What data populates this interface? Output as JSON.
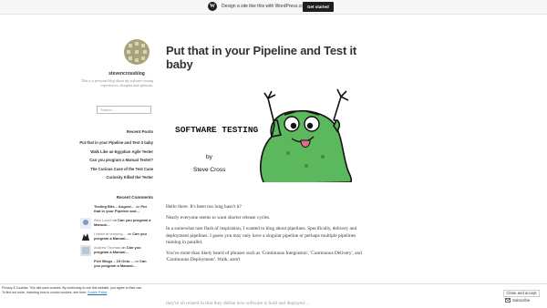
{
  "banner": {
    "text": "Design a site like this with WordPress.com",
    "button": "Get started"
  },
  "site": {
    "title": "stevencrossblog",
    "description": "This is a personal blog about my software testing experiences, thoughts and opinions."
  },
  "search": {
    "placeholder": "Search …"
  },
  "recent_posts": {
    "title": "Recent Posts",
    "items": [
      "Put that in your Pipeline and Test it baby",
      "Walk Like an Egyptian Agile Tester",
      "Can you program a Manual Tester?",
      "The Curious Case of the Test Case",
      "Curiosity Killed the Tester"
    ]
  },
  "recent_comments": {
    "title": "Recent Comments",
    "items": [
      {
        "author": "Testing Bits – August…",
        "on": "on",
        "post": "Put that in your Pipeline and…"
      },
      {
        "author": "Alex Lovell",
        "on": "on",
        "post": "Can you program a Manual…"
      },
      {
        "author": "I failed at learning…",
        "on": "on",
        "post": "Can you program a Manual…"
      },
      {
        "author": "Andrew Thomas",
        "on": "on",
        "post": "Can you program a Manual…"
      },
      {
        "author": "Five Blogs – 19 Octo…",
        "on": "on",
        "post": "Can you program a Manual…"
      }
    ]
  },
  "post": {
    "title": "Put that in your Pipeline and Test it baby",
    "hero": {
      "heading": "SOFTWARE TESTING",
      "by": "by",
      "author": "Steve Cross"
    },
    "paragraphs": [
      "Hello there. It's been too long hasn't it?",
      "Nearly everyone seems to want shorter release cycles.",
      "In a somewhat rare flash of inspiration, I wanted to blog about pipelines. Specifically, delivery and deployment pipelines. I guess you may only have a singular pipeline or perhaps multiple pipelines running in parallel.",
      "You've more than likely heard of phrases such as 'Continuous Integration', 'Continuous Delivery', and 'Continuous Deployment'. Walk, aren't"
    ],
    "overflow": "they're all related in that they define how software is built and deployed…"
  },
  "cookie": {
    "text": "Privacy & Cookies: This site uses cookies. By continuing to use this website, you agree to their use.",
    "more": "To find out more, including how to control cookies, see here:",
    "link": "Cookie Policy",
    "close": "Close and accept"
  },
  "subscribe": {
    "label": "Subscribe"
  },
  "colors": {
    "banner_bg": "#f6f7f7",
    "button_bg": "#1e1e1e",
    "mascot": "#5cb85c",
    "link": "#2271b1"
  }
}
